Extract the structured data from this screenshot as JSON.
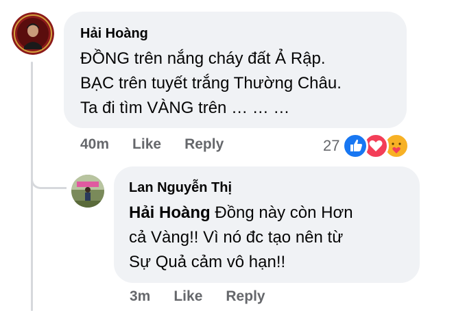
{
  "comment": {
    "author": "Hải Hoàng",
    "lines": [
      "ĐỒNG trên nắng cháy đất Ả Rập.",
      "BẠC trên tuyết trắng Thường Châu.",
      "Ta đi tìm VÀNG trên … … …"
    ],
    "time": "40m",
    "like_label": "Like",
    "reply_label": "Reply",
    "reaction_count": "27",
    "reactions": [
      "like-icon",
      "love-icon",
      "care-icon"
    ]
  },
  "reply": {
    "author": "Lan Nguyễn Thị",
    "mention": "Hải Hoàng",
    "line1_rest": " Đồng này còn Hơn",
    "line2": "cả Vàng!! Vì nó đc tạo nên từ",
    "line3": "Sự Quả cảm vô hạn!!",
    "time": "3m",
    "like_label": "Like",
    "reply_label": "Reply"
  },
  "colors": {
    "bubble": "#f0f2f5",
    "meta_text": "#65676b",
    "like": "#1877f2",
    "love": "#f33e58",
    "care": "#f7b125"
  }
}
